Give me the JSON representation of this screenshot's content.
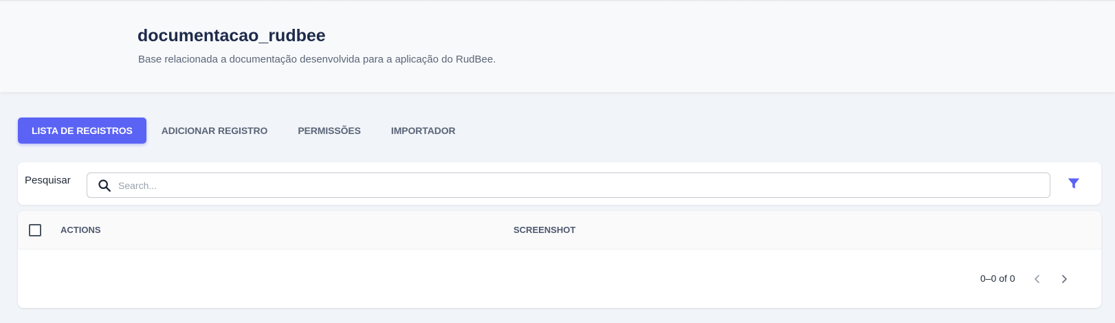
{
  "header": {
    "title": "documentacao_rudbee",
    "subtitle": "Base relacionada a documentação desenvolvida para a aplicação do RudBee."
  },
  "tabs": [
    {
      "label": "LISTA DE REGISTROS",
      "active": true
    },
    {
      "label": "ADICIONAR REGISTRO",
      "active": false
    },
    {
      "label": "PERMISSÕES",
      "active": false
    },
    {
      "label": "IMPORTADOR",
      "active": false
    }
  ],
  "search": {
    "label": "Pesquisar",
    "placeholder": "Search...",
    "value": "",
    "icon": "search-icon",
    "filter_icon": "filter-icon"
  },
  "table": {
    "columns": [
      "ACTIONS",
      "SCREENSHOT"
    ],
    "rows": []
  },
  "pagination": {
    "info": "0–0 of 0",
    "prev_icon": "chevron-left-icon",
    "next_icon": "chevron-right-icon"
  },
  "colors": {
    "accent": "#5b63f5",
    "title": "#1e2a4a",
    "background": "#f1f4f8"
  }
}
